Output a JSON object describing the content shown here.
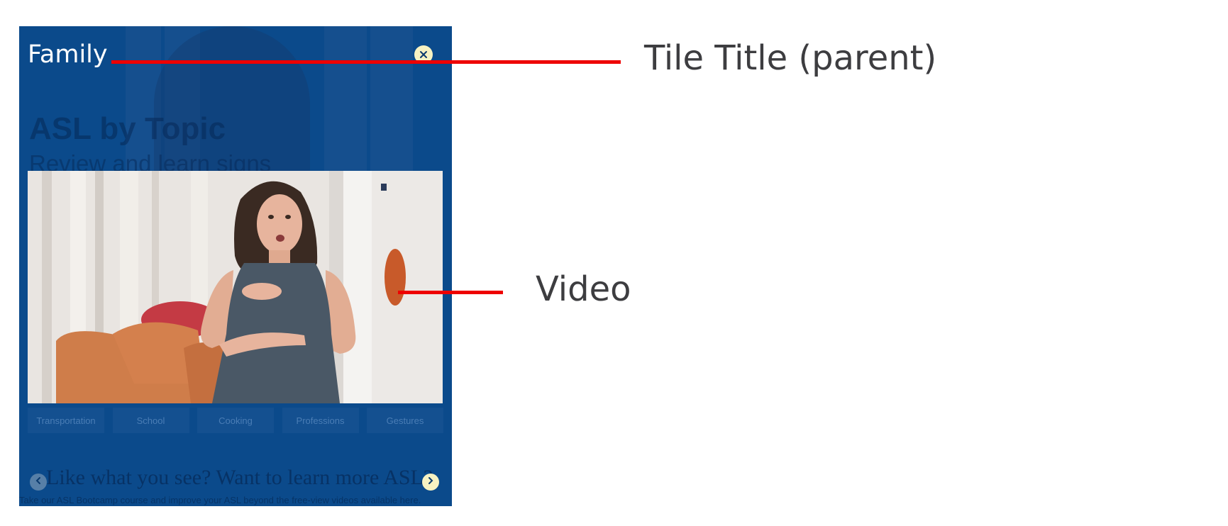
{
  "tile": {
    "title": "Family",
    "background_heading": "ASL by Topic",
    "background_subheading": "Review and learn signs",
    "topics": [
      "Transportation",
      "School",
      "Cooking",
      "Professions",
      "Gestures"
    ],
    "promo_heading": "Like what you see? Want to learn more ASL?",
    "promo_text": "Take our ASL Bootcamp course and improve your ASL beyond the free-view videos available here.",
    "close_icon": "close-icon",
    "prev_icon": "chevron-left-icon",
    "next_icon": "chevron-right-icon",
    "background_color": "#0b4a8b",
    "button_accent_color": "#f7f2c2"
  },
  "annotations": {
    "title_label": "Tile Title (parent)",
    "video_label": "Video",
    "line_color": "#ee0000",
    "label_color": "#3d3d40"
  }
}
